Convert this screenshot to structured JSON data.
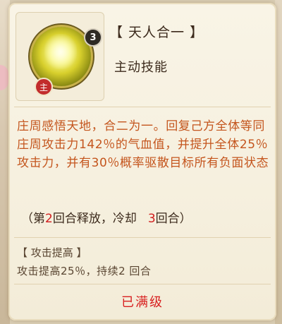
{
  "skill": {
    "title": "【 天人合一 】",
    "type": "主动技能",
    "level": "3",
    "main_badge": "主",
    "description": "庄周感悟天地，合二为一。回复己方全体等同庄周攻击力142％的气血值，并提升全体25％攻击力，并有30％概率驱散目标所有负面状态",
    "cooldown": {
      "prefix": "（第",
      "release_round": "2",
      "middle": "回合释放，冷却",
      "cooldown_rounds": "3",
      "suffix": "回合）"
    },
    "buff": {
      "name": "【 攻击提高 】",
      "description": "攻击提高25％，持续2 回合"
    },
    "status": "已满级"
  },
  "colors": {
    "description": "#c4551d",
    "highlight_number": "#d11d1d",
    "status": "#d81f1f"
  }
}
